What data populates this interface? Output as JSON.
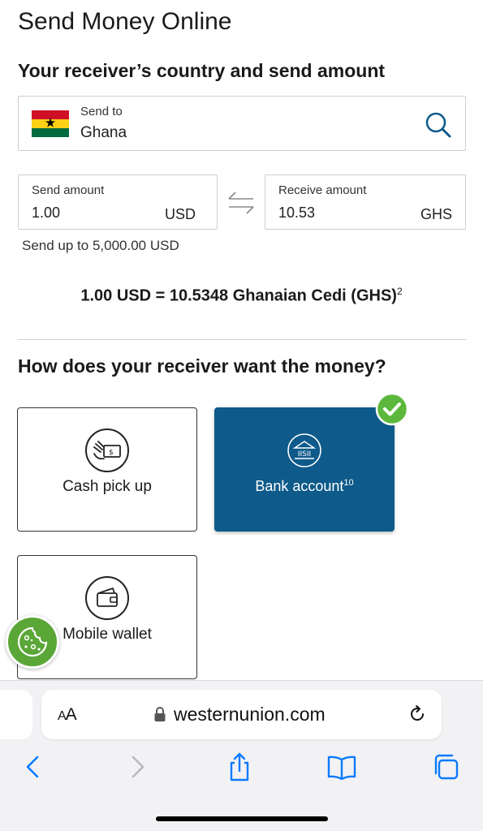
{
  "page": {
    "title": "Send Money Online",
    "section_title": "Your receiver’s country and send amount"
  },
  "country": {
    "label": "Send to",
    "value": "Ghana",
    "flag_icon": "ghana-flag-icon",
    "flag_colors": [
      "#ce1126",
      "#fcd116",
      "#006b3f"
    ]
  },
  "send": {
    "label": "Send amount",
    "value": "1.00",
    "currency": "USD",
    "limit_text": "Send up to 5,000.00 USD"
  },
  "receive": {
    "label": "Receive amount",
    "value": "10.53",
    "currency": "GHS"
  },
  "rate": {
    "text": "1.00 USD = 10.5348 Ghanaian Cedi (GHS)",
    "footnote": "2"
  },
  "delivery": {
    "question": "How does your receiver want the money?",
    "options": [
      {
        "label": "Cash pick up",
        "footnote": "",
        "selected": false,
        "icon": "cash-hand-icon"
      },
      {
        "label": "Bank account",
        "footnote": "10",
        "selected": true,
        "icon": "bank-icon"
      },
      {
        "label": "Mobile wallet",
        "footnote": "",
        "selected": false,
        "icon": "wallet-icon"
      }
    ],
    "bank_icon_text": "IISII"
  },
  "browser": {
    "aa_label_big": "A",
    "aa_label_small": "A",
    "url": "westernunion.com"
  },
  "colors": {
    "accent": "#0e5a8a",
    "check": "#5cb83c",
    "cookie": "#5aa636",
    "ios_blue": "#0a7aff"
  }
}
